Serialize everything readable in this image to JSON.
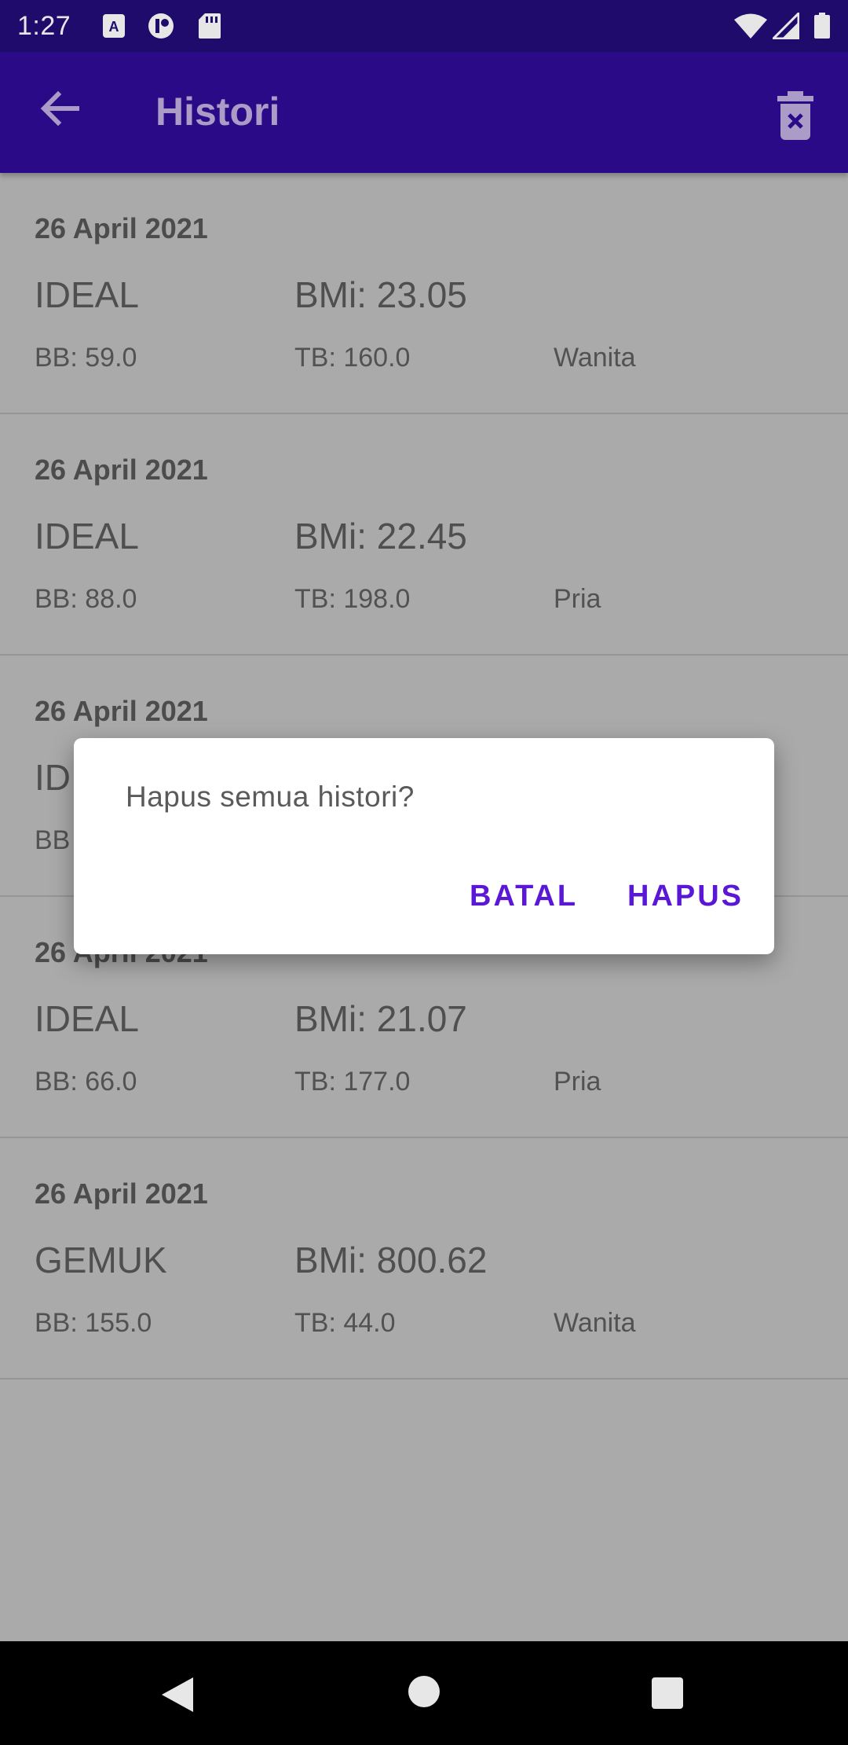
{
  "status_bar": {
    "time": "1:27",
    "icons": [
      "a-notification-icon",
      "app-notification-icon",
      "sd-card-icon",
      "wifi-icon",
      "signal-icon",
      "battery-icon"
    ]
  },
  "app_bar": {
    "title": "Histori",
    "back_icon": "arrow-left-icon",
    "delete_icon": "trash-x-icon"
  },
  "history": [
    {
      "date": "26 April 2021",
      "status": "IDEAL",
      "bmi": "BMi: 23.05",
      "bb": "BB: 59.0",
      "tb": "TB: 160.0",
      "gender": "Wanita"
    },
    {
      "date": "26 April 2021",
      "status": "IDEAL",
      "bmi": "BMi: 22.45",
      "bb": "BB: 88.0",
      "tb": "TB: 198.0",
      "gender": "Pria"
    },
    {
      "date": "26 April 2021",
      "status": "ID",
      "bmi": "",
      "bb": "BB",
      "tb": "",
      "gender": ""
    },
    {
      "date": "26 April 2021",
      "status": "IDEAL",
      "bmi": "BMi: 21.07",
      "bb": "BB: 66.0",
      "tb": "TB: 177.0",
      "gender": "Pria"
    },
    {
      "date": "26 April 2021",
      "status": "GEMUK",
      "bmi": "BMi: 800.62",
      "bb": "BB: 155.0",
      "tb": "TB: 44.0",
      "gender": "Wanita"
    }
  ],
  "dialog": {
    "message": "Hapus semua histori?",
    "cancel_label": "BATAL",
    "confirm_label": "HAPUS"
  },
  "colors": {
    "status_bar": "#1f0b6b",
    "app_bar": "#2a0a86",
    "accent": "#5a18d6",
    "scrim_bg": "#aaaaaa"
  }
}
